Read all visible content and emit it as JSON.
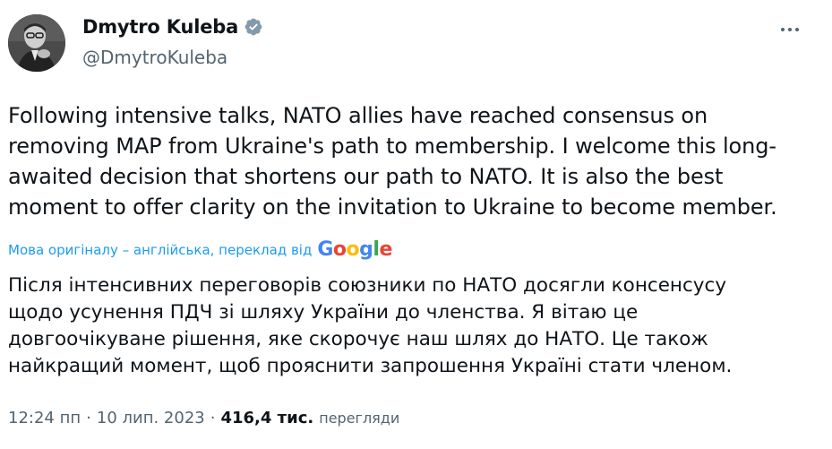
{
  "author": {
    "name": "Dmytro Kuleba",
    "handle": "@DmytroKuleba",
    "verified_color": "#829aab"
  },
  "tweet": {
    "text_en": "Following intensive talks, NATO allies have reached consensus on\nremoving MAP from Ukraine's path to membership. I welcome this long-\nawaited decision that shortens our path to NATO. It is also the best\nmoment to offer clarity on the invitation to Ukraine to become member.",
    "translation_label": "Мова оригіналу – англійська, переклад від",
    "translation_provider": "Google",
    "text_uk": "Після інтенсивних переговорів союзники по НАТО досягли консенсусу\nщодо усунення ПДЧ зі шляху України до членства. Я вітаю це\nдовгоочікуване рішення, яке скорочує наш шлях до НАТО. Це також\nнайкращий момент, щоб прояснити запрошення Україні стати членом.",
    "time": "12:24 пп",
    "date": "10 лип. 2023",
    "views_count": "416,4 тис.",
    "views_label": "перегляди"
  },
  "icons": {
    "more": "more-horizontal-icon",
    "verified": "verified-badge-icon"
  },
  "colors": {
    "link": "#1d9bf0",
    "secondary": "#536471",
    "primary_text": "#0f1419"
  }
}
